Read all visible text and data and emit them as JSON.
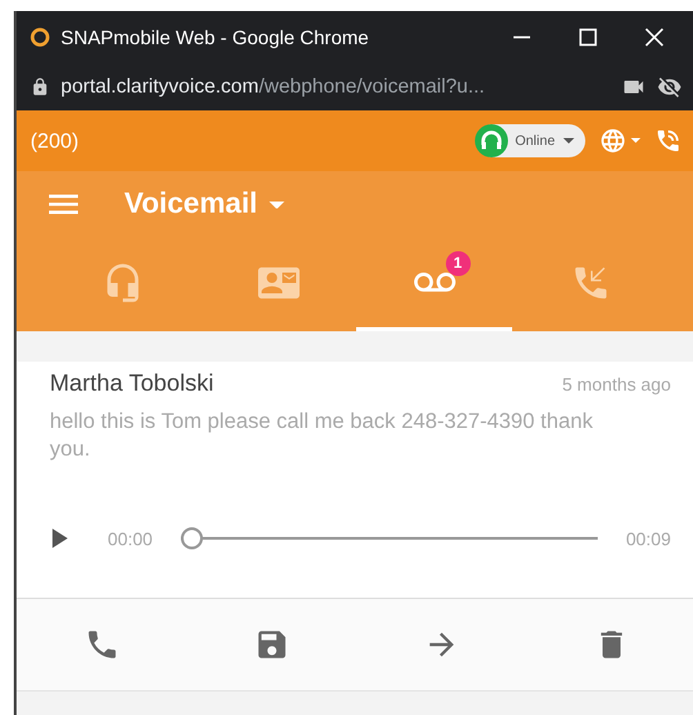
{
  "window": {
    "title": "SNAPmobile Web - Google Chrome"
  },
  "address_bar": {
    "host": "portal.clarityvoice.com",
    "path": "/webphone/voicemail?u..."
  },
  "status_bar": {
    "extension": "(200)",
    "presence": "Online"
  },
  "header": {
    "title": "Voicemail"
  },
  "tabs": [
    {
      "kind": "headset",
      "selected": false
    },
    {
      "kind": "contacts",
      "selected": false
    },
    {
      "kind": "voicemail",
      "selected": true,
      "badge": "1"
    },
    {
      "kind": "history",
      "selected": false
    }
  ],
  "voicemail": {
    "caller": "Martha Tobolski",
    "time": "5 months ago",
    "transcript": "hello this is Tom please call me back 248-327-4390 thank you.",
    "player": {
      "elapsed": "00:00",
      "duration": "00:09",
      "level": 0
    }
  },
  "actions": [
    {
      "kind": "call"
    },
    {
      "kind": "save"
    },
    {
      "kind": "forward"
    },
    {
      "kind": "delete"
    }
  ]
}
